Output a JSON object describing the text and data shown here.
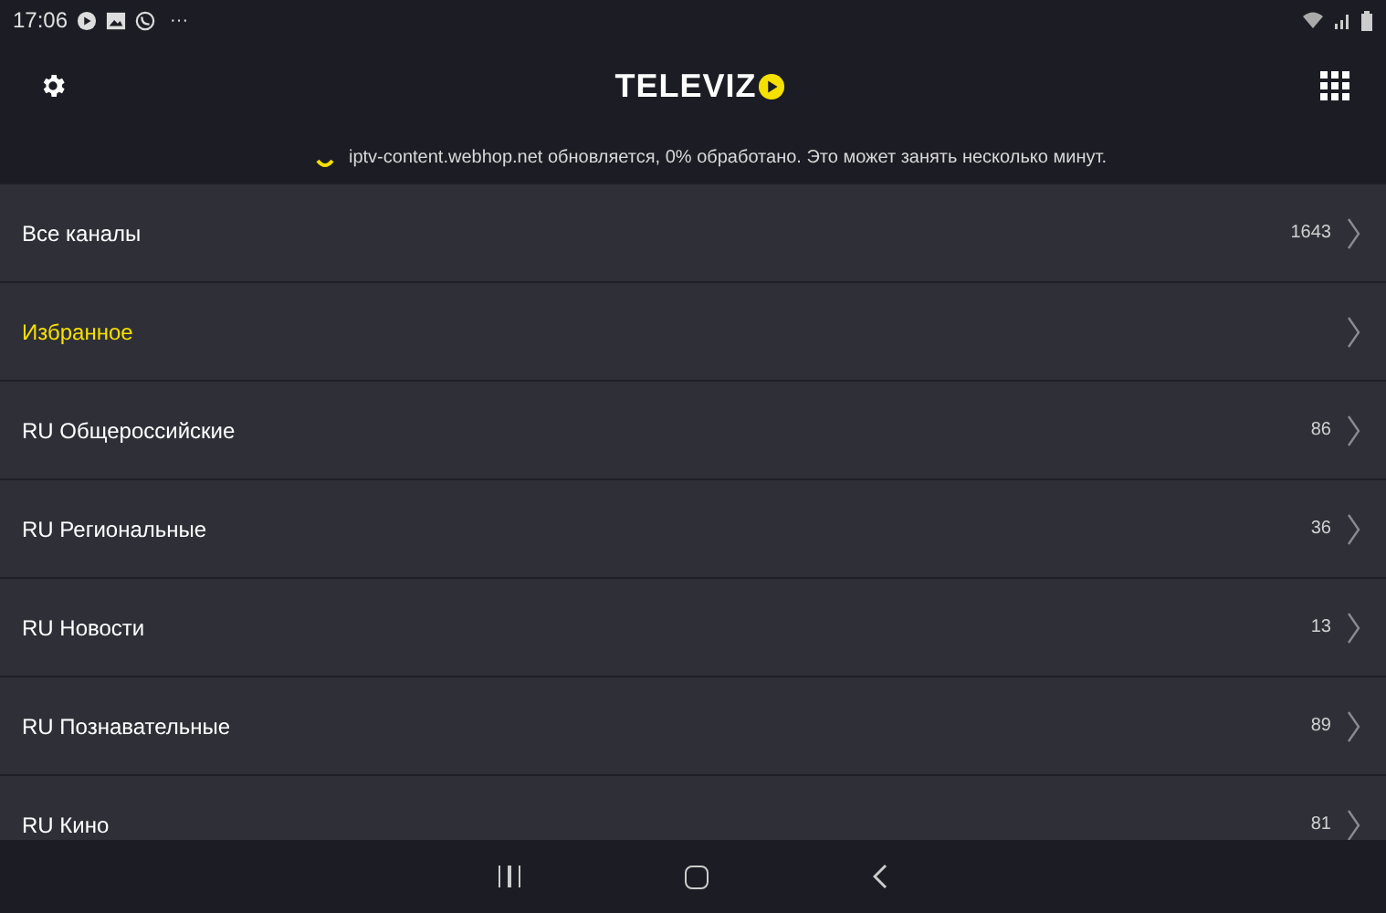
{
  "status_bar": {
    "time": "17:06",
    "more": "···"
  },
  "header": {
    "logo": "TELEVIZ"
  },
  "notice": {
    "text": "iptv-content.webhop.net обновляется, 0% обработано. Это может занять несколько минут."
  },
  "groups": [
    {
      "name": "Все каналы",
      "count": "1643",
      "highlighted": false
    },
    {
      "name": "Избранное",
      "highlighted": true
    },
    {
      "name": "RU Общероссийские",
      "count": "86",
      "highlighted": false
    },
    {
      "name": "RU Региональные",
      "count": "36",
      "highlighted": false
    },
    {
      "name": "RU Новости",
      "count": "13",
      "highlighted": false
    },
    {
      "name": "RU Познавательные",
      "count": "89",
      "highlighted": false
    },
    {
      "name": "RU Кино",
      "count": "81",
      "highlighted": false
    }
  ]
}
